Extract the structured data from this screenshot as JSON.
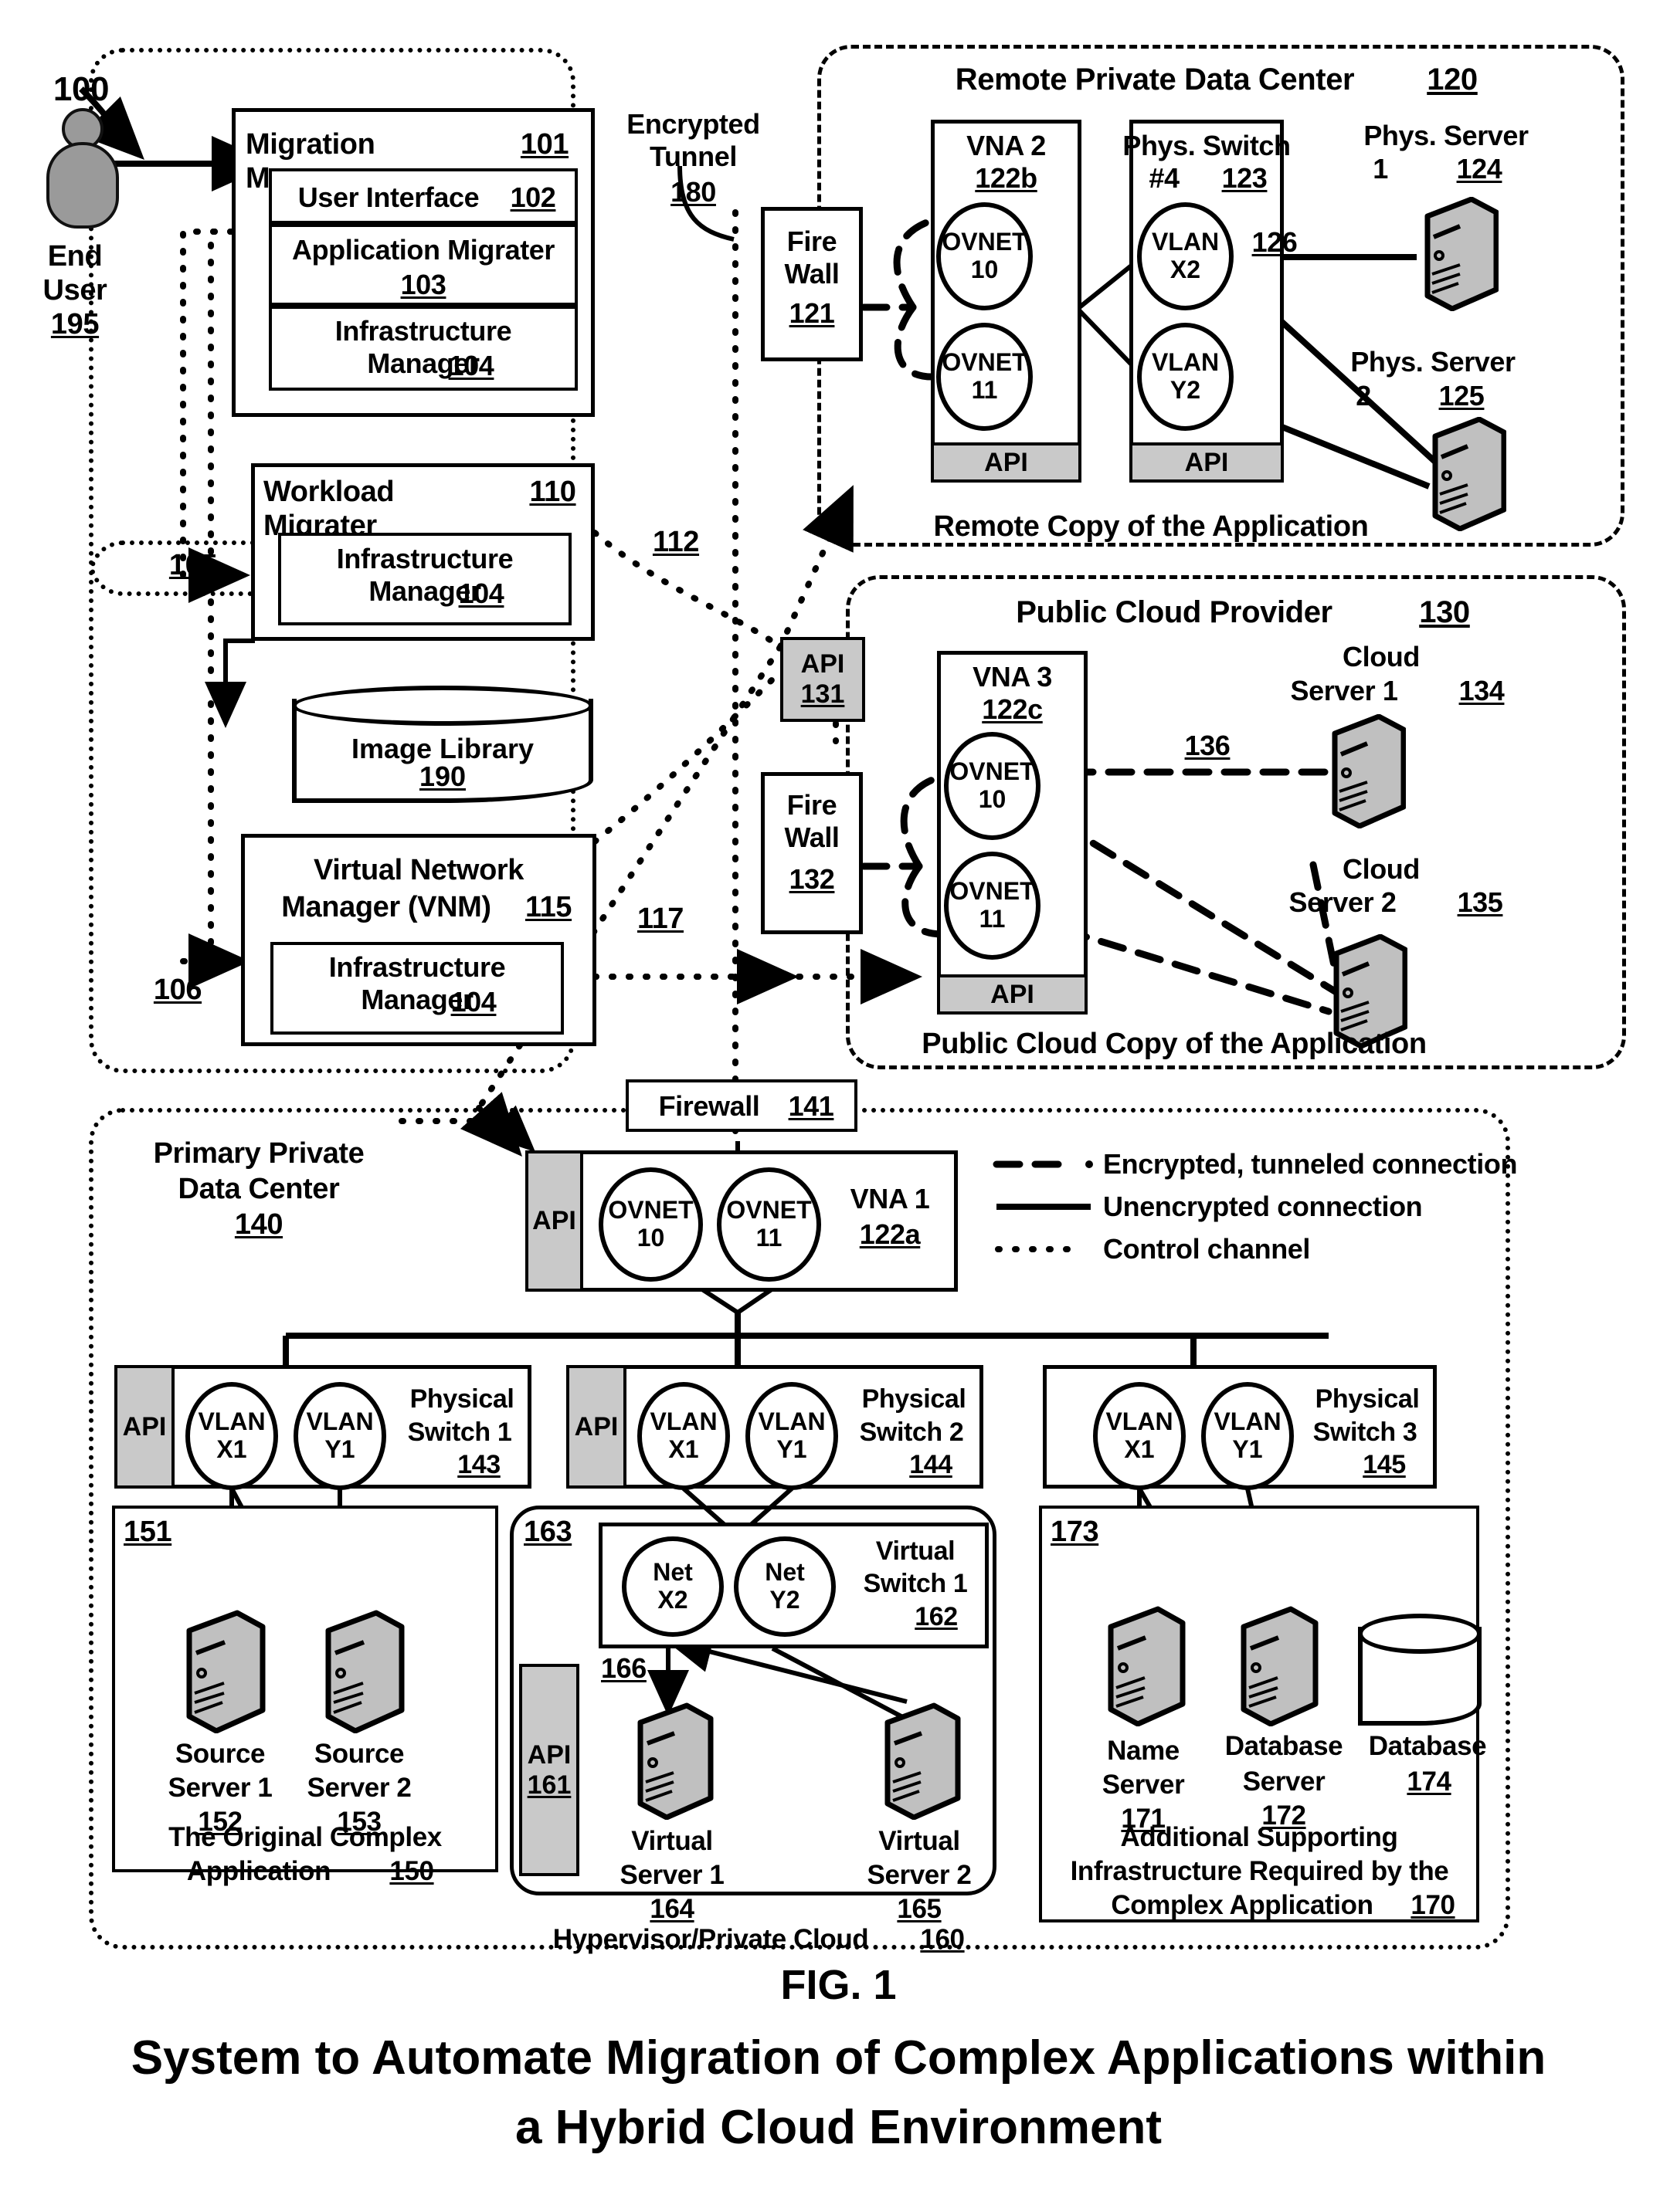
{
  "figure": {
    "number": "FIG. 1",
    "title_line1": "System to Automate Migration of Complex Applications within",
    "title_line2": "a Hybrid Cloud Environment",
    "system_ref": "100"
  },
  "end_user": {
    "label": "End\nUser",
    "ref": "195"
  },
  "migration_manager": {
    "title": "Migration Manager",
    "ref": "101",
    "rows": [
      {
        "label": "User Interface",
        "ref": "102"
      },
      {
        "label": "Application Migrater",
        "ref": "103"
      },
      {
        "label": "Infrastructure\nManager",
        "ref": "104"
      }
    ]
  },
  "workload_migrater": {
    "title": "Workload Migrater",
    "ref": "110",
    "inner": {
      "label": "Infrastructure\nManager",
      "ref": "104"
    }
  },
  "image_library": {
    "label": "Image Library",
    "ref": "190"
  },
  "vnm": {
    "title_line1": "Virtual Network",
    "title_line2": "Manager (VNM)",
    "ref": "115",
    "inner": {
      "label": "Infrastructure\nManager",
      "ref": "104"
    }
  },
  "control_refs": {
    "mm_to_wm": "105",
    "mm_to_vnm": "106",
    "wm_out": "112",
    "vnm_out": "117"
  },
  "encrypted_tunnel": {
    "label": "Encrypted\nTunnel",
    "ref": "180"
  },
  "remote_dc": {
    "title": "Remote Private Data Center",
    "ref": "120",
    "firewall": {
      "label": "Fire\nWall",
      "ref": "121"
    },
    "vna": {
      "label": "VNA 2",
      "ref": "122b",
      "ovnets": [
        "OVNET\n10",
        "OVNET\n11"
      ],
      "api": "API"
    },
    "switch": {
      "label": "Phys. Switch",
      "label2": "#4",
      "ref": "123",
      "vlans": [
        "VLAN\nX2",
        "VLAN\nY2"
      ],
      "api": "API"
    },
    "link_ref": "126",
    "servers": [
      {
        "label": "Phys. Server",
        "label2": "1",
        "ref": "124"
      },
      {
        "label": "Phys. Server",
        "label2": "2",
        "ref": "125"
      }
    ],
    "caption": "Remote Copy of the Application"
  },
  "public_cloud": {
    "title": "Public Cloud Provider",
    "ref": "130",
    "api": {
      "label": "API",
      "ref": "131"
    },
    "firewall": {
      "label": "Fire\nWall",
      "ref": "132"
    },
    "vna": {
      "label": "VNA 3",
      "ref": "122c",
      "ovnets": [
        "OVNET\n10",
        "OVNET\n11"
      ],
      "api": "API"
    },
    "link_ref": "136",
    "servers": [
      {
        "label": "Cloud",
        "label2": "Server 1",
        "ref": "134"
      },
      {
        "label": "Cloud",
        "label2": "Server 2",
        "ref": "135"
      }
    ],
    "caption": "Public Cloud Copy of the Application"
  },
  "primary_dc": {
    "title_line1": "Primary Private",
    "title_line2": "Data Center",
    "ref": "140",
    "firewall": {
      "label": "Firewall",
      "ref": "141"
    },
    "vna": {
      "label": "VNA 1",
      "ref": "122a",
      "api": "API",
      "ovnets": [
        "OVNET\n10",
        "OVNET\n11"
      ]
    },
    "switches": [
      {
        "api": "API",
        "vlans": [
          "VLAN\nX1",
          "VLAN\nY1"
        ],
        "label": "Physical",
        "label2": "Switch 1",
        "ref": "143"
      },
      {
        "api": "API",
        "vlans": [
          "VLAN\nX1",
          "VLAN\nY1"
        ],
        "label": "Physical",
        "label2": "Switch 2",
        "ref": "144"
      },
      {
        "api": "API",
        "vlans": [
          "VLAN\nX1",
          "VLAN\nY1"
        ],
        "label": "Physical",
        "label2": "Switch 3",
        "ref": "145"
      }
    ],
    "original_app": {
      "ref": "151",
      "servers": [
        {
          "label": "Source",
          "label2": "Server 1",
          "ref": "152"
        },
        {
          "label": "Source",
          "label2": "Server 2",
          "ref": "153"
        }
      ],
      "caption_line1": "The Original Complex",
      "caption_line2": "Application",
      "caption_ref": "150"
    },
    "hypervisor": {
      "ref_switch": "163",
      "api": {
        "label": "API",
        "ref": "161"
      },
      "vswitch": {
        "nets": [
          "Net\nX2",
          "Net\nY2"
        ],
        "label": "Virtual",
        "label2": "Switch 1",
        "ref": "162"
      },
      "net_ref": "166",
      "servers": [
        {
          "label": "Virtual",
          "label2": "Server 1",
          "ref": "164"
        },
        {
          "label": "Virtual",
          "label2": "Server 2",
          "ref": "165"
        }
      ],
      "caption": "Hypervisor/Private Cloud",
      "caption_ref": "160"
    },
    "supporting": {
      "ref": "173",
      "servers": [
        {
          "label": "Name",
          "label2": "Server",
          "ref": "171"
        },
        {
          "label": "Database",
          "label2": "Server",
          "ref": "172"
        }
      ],
      "database": {
        "label": "Database",
        "ref": "174"
      },
      "caption_line1": "Additional Supporting",
      "caption_line2": "Infrastructure Required by the",
      "caption_line3": "Complex Application",
      "caption_ref": "170"
    }
  },
  "legend": {
    "items": [
      {
        "style": "encrypted",
        "label": "Encrypted, tunneled connection"
      },
      {
        "style": "solid",
        "label": "Unencrypted connection"
      },
      {
        "style": "control",
        "label": "Control channel"
      }
    ]
  },
  "colors": {
    "api_fill": "#c9c9c9",
    "line": "#000000",
    "background": "#ffffff"
  }
}
